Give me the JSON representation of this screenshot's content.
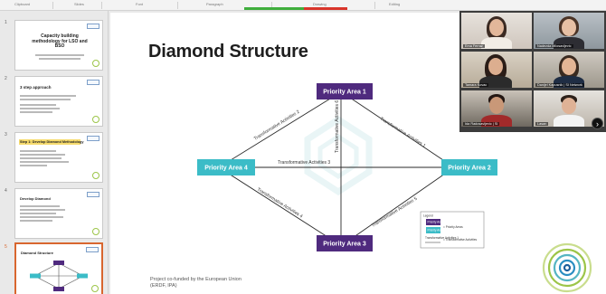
{
  "ribbon": {
    "groups": [
      "Clipboard",
      "Slides",
      "Font",
      "Paragraph",
      "Drawing",
      "Editing"
    ]
  },
  "thumbnails": [
    {
      "num": "1",
      "title": "Capacity building methodology for LSO and BSO"
    },
    {
      "num": "2",
      "title": "3 step approach"
    },
    {
      "num": "3",
      "title": "Step 1: Develop Diamond Methodology"
    },
    {
      "num": "4",
      "title": "Develop Diamond"
    },
    {
      "num": "5",
      "title": "Diamond Structure"
    }
  ],
  "slide": {
    "title": "Diamond Structure",
    "priority_areas": [
      "Priority Area 1",
      "Priority Area 2",
      "Priority Area 3",
      "Priority Area 4"
    ],
    "transformative_activities": [
      "Transformative Activities 1",
      "Transformative Activities 2",
      "Transformative Activities 3",
      "Transformative Activities 4",
      "Transformative Activities 5",
      "Transformative Activities 6"
    ],
    "legend": {
      "title": "Legend",
      "priority_box": "Priority Area",
      "priority_desc": "= Priority Areas",
      "transformative_box": "Transformative Activities 1",
      "transformative_desc": "= Transformative Activities"
    },
    "footer": [
      "Project co-funded by the European Union",
      "(ERDF, IPA)"
    ],
    "colors": {
      "purple": "#4f2a7e",
      "teal": "#3bbcc7",
      "line": "#2a2a2a"
    }
  },
  "participants": [
    "Ema Ferraz",
    "Nadezda Milosavljevic",
    "Tamara Kovac",
    "Danijel Kapusnik | SI Network",
    "Ida Radosavljevic | SI",
    "Lasan"
  ]
}
